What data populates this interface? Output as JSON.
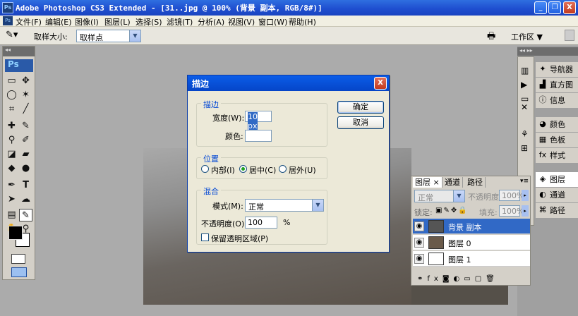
{
  "window": {
    "title": "Adobe Photoshop CS3 Extended - [31..jpg @ 100% (背景 副本, RGB/8#)]",
    "min": "_",
    "restore": "❐",
    "close": "X"
  },
  "menu": [
    "文件(F)",
    "编辑(E)",
    "图像(I)",
    "图层(L)",
    "选择(S)",
    "滤镜(T)",
    "分析(A)",
    "视图(V)",
    "窗口(W)",
    "帮助(H)"
  ],
  "options": {
    "sample_size_label": "取样大小:",
    "sample_size_value": "取样点",
    "workspace_label": "工作区 ▼"
  },
  "toolbox": {
    "ps_label": "Ps"
  },
  "dialog": {
    "title": "描边",
    "stroke_group": "描边",
    "width_label": "宽度(W):",
    "width_value": "10 px",
    "color_label": "颜色:",
    "position_group": "位置",
    "inside_label": "内部(I)",
    "center_label": "居中(C)",
    "outside_label": "居外(U)",
    "blend_group": "混合",
    "mode_label": "模式(M):",
    "mode_value": "正常",
    "opacity_label": "不透明度(O):",
    "opacity_value": "100",
    "opacity_unit": "%",
    "preserve_label": "保留透明区域(P)",
    "ok_label": "确定",
    "cancel_label": "取消"
  },
  "right_panels": [
    "导航器",
    "直方图",
    "信息",
    "颜色",
    "色板",
    "样式",
    "图层",
    "通道",
    "路径"
  ],
  "layers_panel": {
    "tabs": [
      "图层 ×",
      "通道",
      "路径"
    ],
    "blend_mode": "正常",
    "opacity_label": "不透明度:",
    "opacity_value": "100%",
    "lock_label": "锁定:",
    "fill_label": "填充:",
    "fill_value": "100%",
    "layers": [
      {
        "name": "背景 副本",
        "selected": true
      },
      {
        "name": "图层 0",
        "selected": false
      },
      {
        "name": "图层 1",
        "selected": false
      }
    ]
  }
}
